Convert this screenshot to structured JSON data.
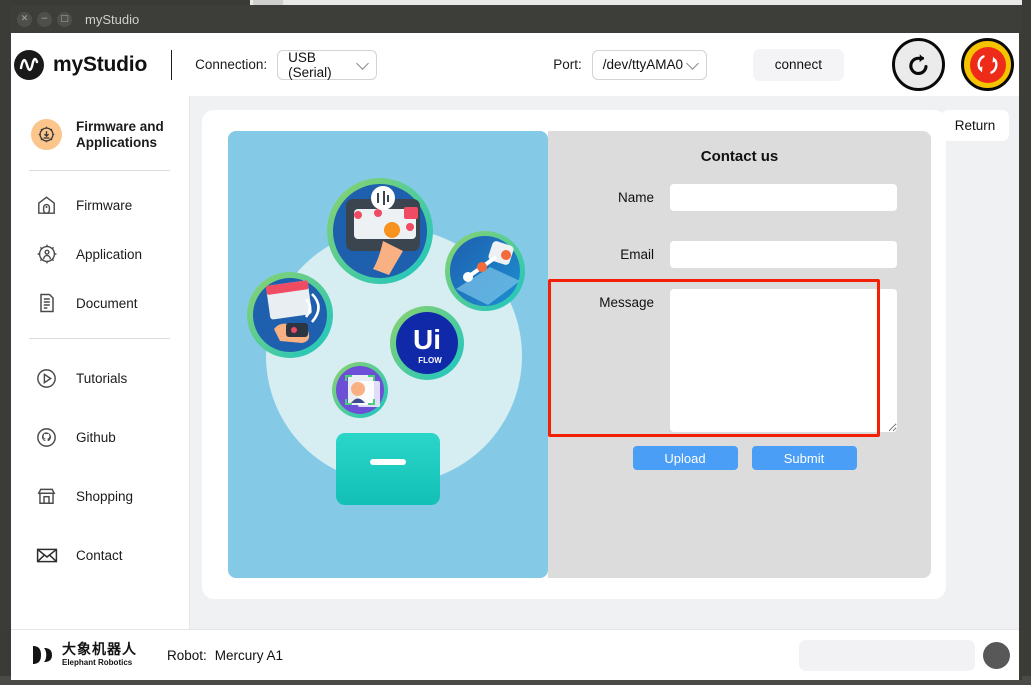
{
  "window": {
    "title": "myStudio",
    "controls": [
      {
        "name": "close",
        "glyph": "✕"
      },
      {
        "name": "minimize",
        "glyph": "−"
      },
      {
        "name": "maximize",
        "glyph": "□"
      }
    ]
  },
  "toolbar": {
    "brand": "myStudio",
    "connection_label": "Connection:",
    "connection_value": "USB (Serial)",
    "port_label": "Port:",
    "port_value": "/dev/ttyAMA0",
    "connect_label": "connect",
    "restart_icon": "restart-icon",
    "estop_icon": "emergency-stop-icon"
  },
  "sidebar": {
    "items": [
      {
        "label": "Firmware and Applications",
        "icon": "gear-download-icon",
        "active": true
      },
      {
        "label": "Firmware",
        "icon": "chip-home-icon",
        "active": false
      },
      {
        "label": "Application",
        "icon": "gear-person-icon",
        "active": false
      },
      {
        "label": "Document",
        "icon": "document-icon",
        "active": false
      },
      {
        "label": "Tutorials",
        "icon": "play-circle-icon",
        "active": false
      },
      {
        "label": "Github",
        "icon": "github-icon",
        "active": false
      },
      {
        "label": "Shopping",
        "icon": "store-icon",
        "active": false
      },
      {
        "label": "Contact",
        "icon": "envelope-icon",
        "active": false
      }
    ]
  },
  "main": {
    "return_label": "Return",
    "form": {
      "title": "Contact us",
      "name_label": "Name",
      "name_value": "",
      "email_label": "Email",
      "email_value": "",
      "message_label": "Message",
      "message_value": "",
      "upload_label": "Upload",
      "submit_label": "Submit"
    },
    "illustration": {
      "name": "applications-collage-illustration",
      "badge_label": "Ui"
    },
    "highlight": {
      "name": "message-field-highlight",
      "color": "#f41f07"
    }
  },
  "footer": {
    "logo_cn": "大象机器人",
    "logo_en": "Elephant Robotics",
    "robot_label": "Robot:",
    "robot_value": "Mercury A1"
  },
  "colors": {
    "accent_blue": "#4a9ef5",
    "illustration_bg": "#84cae6",
    "form_bg": "#dcdcdc",
    "panel_bg": "#f0f1f3",
    "active_icon_bg": "#fbc58c",
    "estop_yellow": "#f5c400",
    "estop_red": "#ee2b18"
  }
}
